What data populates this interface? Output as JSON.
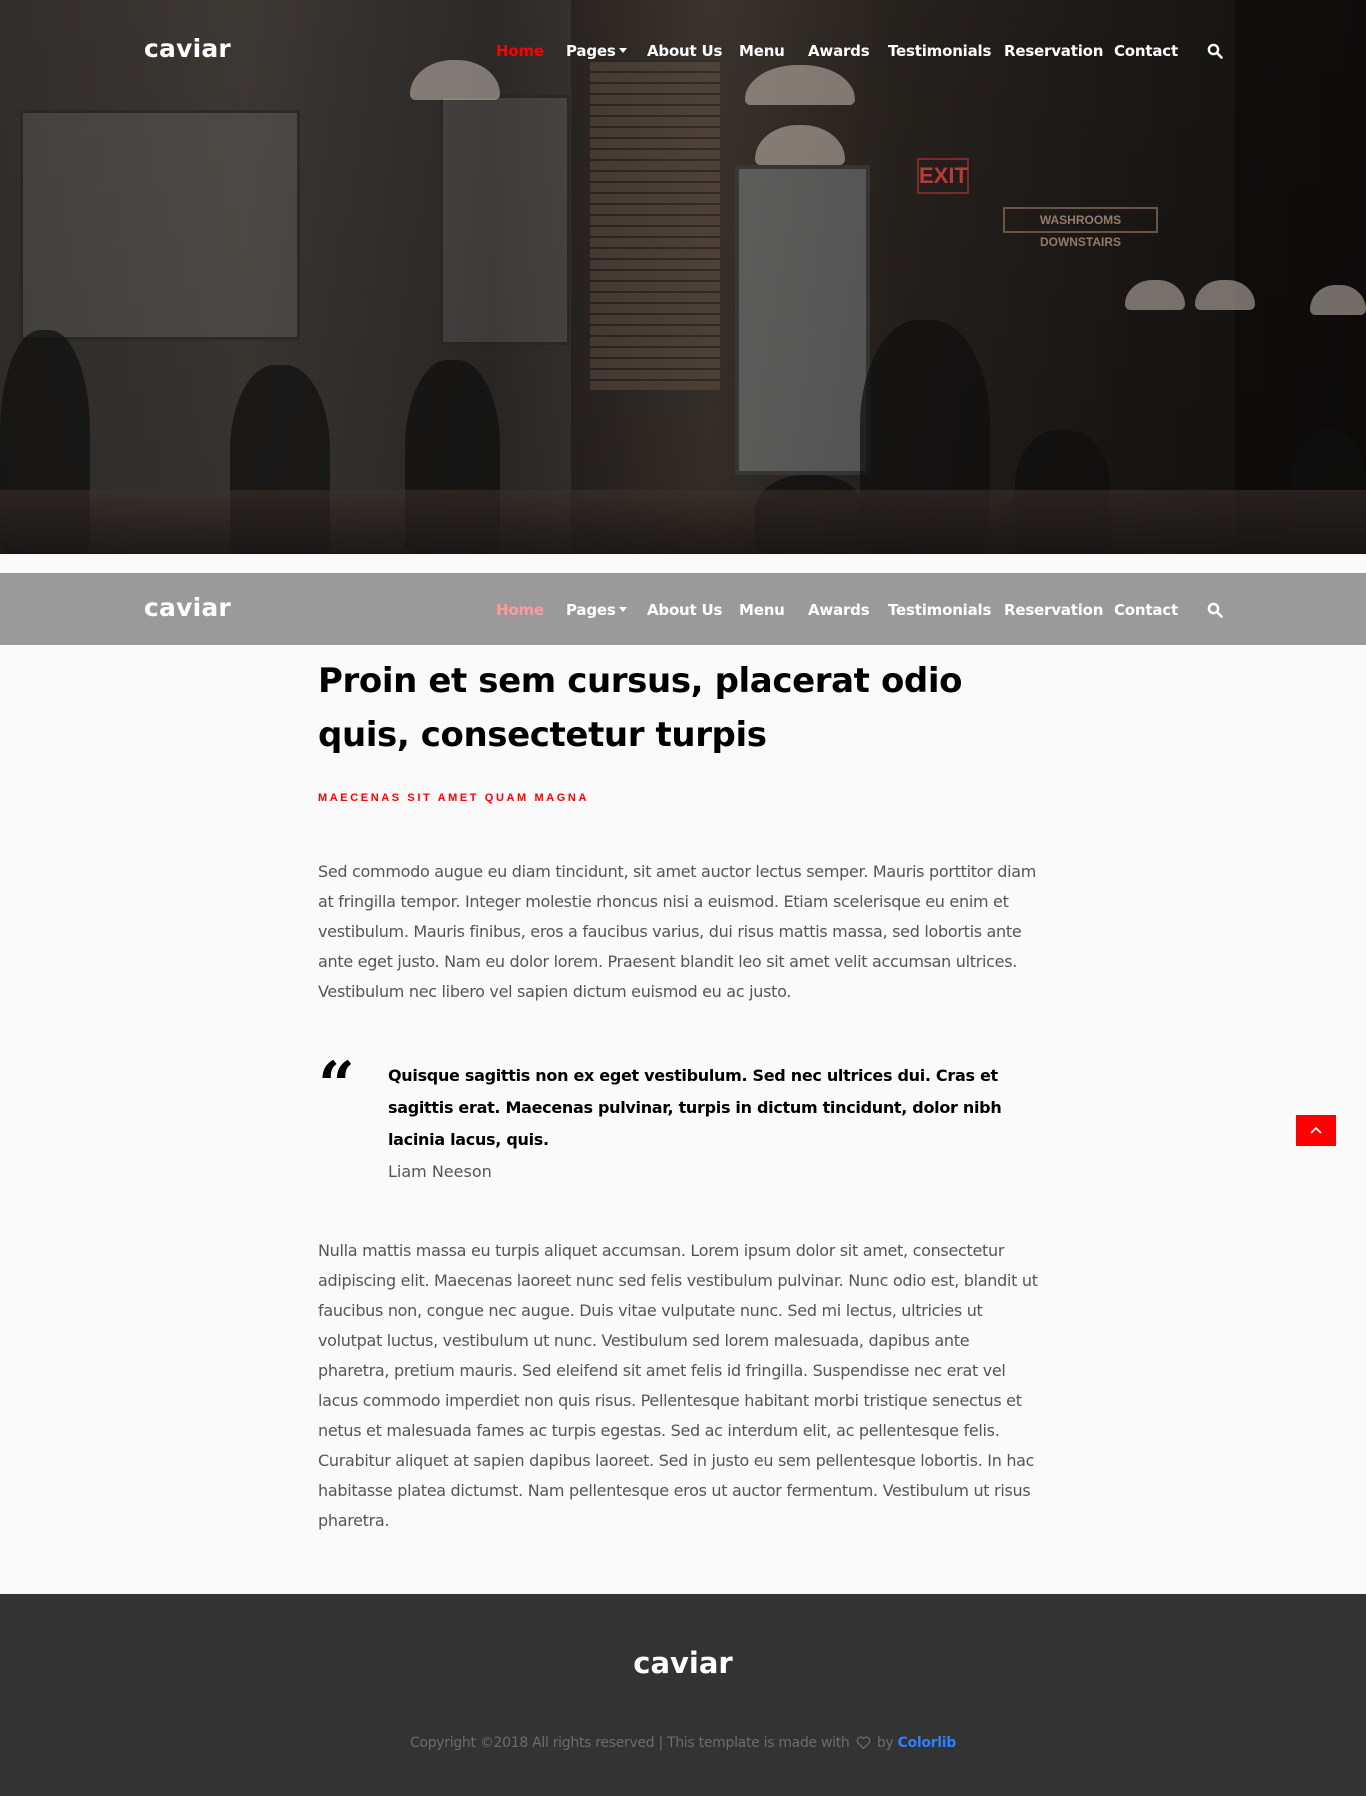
{
  "site": {
    "logo": "caviar"
  },
  "hero": {
    "exit_sign": "EXIT",
    "wall_sign": "WASHROOMS DOWNSTAIRS"
  },
  "nav": {
    "items": [
      {
        "label": "Home",
        "active": true
      },
      {
        "label": "Pages",
        "dropdown": true
      },
      {
        "label": "About Us"
      },
      {
        "label": "Menu"
      },
      {
        "label": "Awards"
      },
      {
        "label": "Testimonials"
      },
      {
        "label": "Reservation"
      },
      {
        "label": "Contact"
      }
    ],
    "search_icon": "search-icon"
  },
  "article": {
    "title": "Proin et sem cursus, placerat odio quis, consectetur turpis",
    "subtitle": "MAECENAS SIT AMET QUAM MAGNA",
    "paragraph_1": "Sed commodo augue eu diam tincidunt, sit amet auctor lectus semper. Mauris porttitor diam at fringilla tempor. Integer molestie rhoncus nisi a euismod. Etiam scelerisque eu enim et vestibulum. Mauris finibus, eros a faucibus varius, dui risus mattis massa, sed lobortis ante ante eget justo. Nam eu dolor lorem. Praesent blandit leo sit amet velit accumsan ultrices. Vestibulum nec libero vel sapien dictum euismod eu ac justo.",
    "quote": {
      "mark": "“",
      "text": "Quisque sagittis non ex eget vestibulum. Sed nec ultrices dui. Cras et sagittis erat. Maecenas pulvinar, turpis in dictum tincidunt, dolor nibh lacinia lacus, quis.",
      "author": "Liam Neeson"
    },
    "paragraph_2": "Nulla mattis massa eu turpis aliquet accumsan. Lorem ipsum dolor sit amet, consectetur adipiscing elit. Maecenas laoreet nunc sed felis vestibulum pulvinar. Nunc odio est, blandit ut faucibus non, congue nec augue. Duis vitae vulputate nunc. Sed mi lectus, ultricies ut volutpat luctus, vestibulum ut nunc. Vestibulum sed lorem malesuada, dapibus ante pharetra, pretium mauris. Sed eleifend sit amet felis id fringilla. Suspendisse nec erat vel lacus commodo imperdiet non quis risus. Pellentesque habitant morbi tristique senectus et netus et malesuada fames ac turpis egestas. Sed ac interdum elit, ac pellentesque felis. Curabitur aliquet at sapien dapibus laoreet. Sed in justo eu sem pellentesque lobortis. In hac habitasse platea dictumst. Nam pellentesque eros ut auctor fermentum. Vestibulum ut risus pharetra."
  },
  "back_to_top": {
    "icon": "chevron-up-icon"
  },
  "footer": {
    "logo": "caviar",
    "copyright_prefix": "Copyright ©2018 All rights reserved | This template is made with",
    "copyright_by": "by",
    "link_text": "Colorlib",
    "heart_icon": "heart-icon"
  },
  "colors": {
    "accent": "#ff0000",
    "sticky_nav_bg": "#9a9a9a",
    "footer_bg": "#333333",
    "link": "#2f80ff",
    "page_bg": "#fafafa"
  }
}
